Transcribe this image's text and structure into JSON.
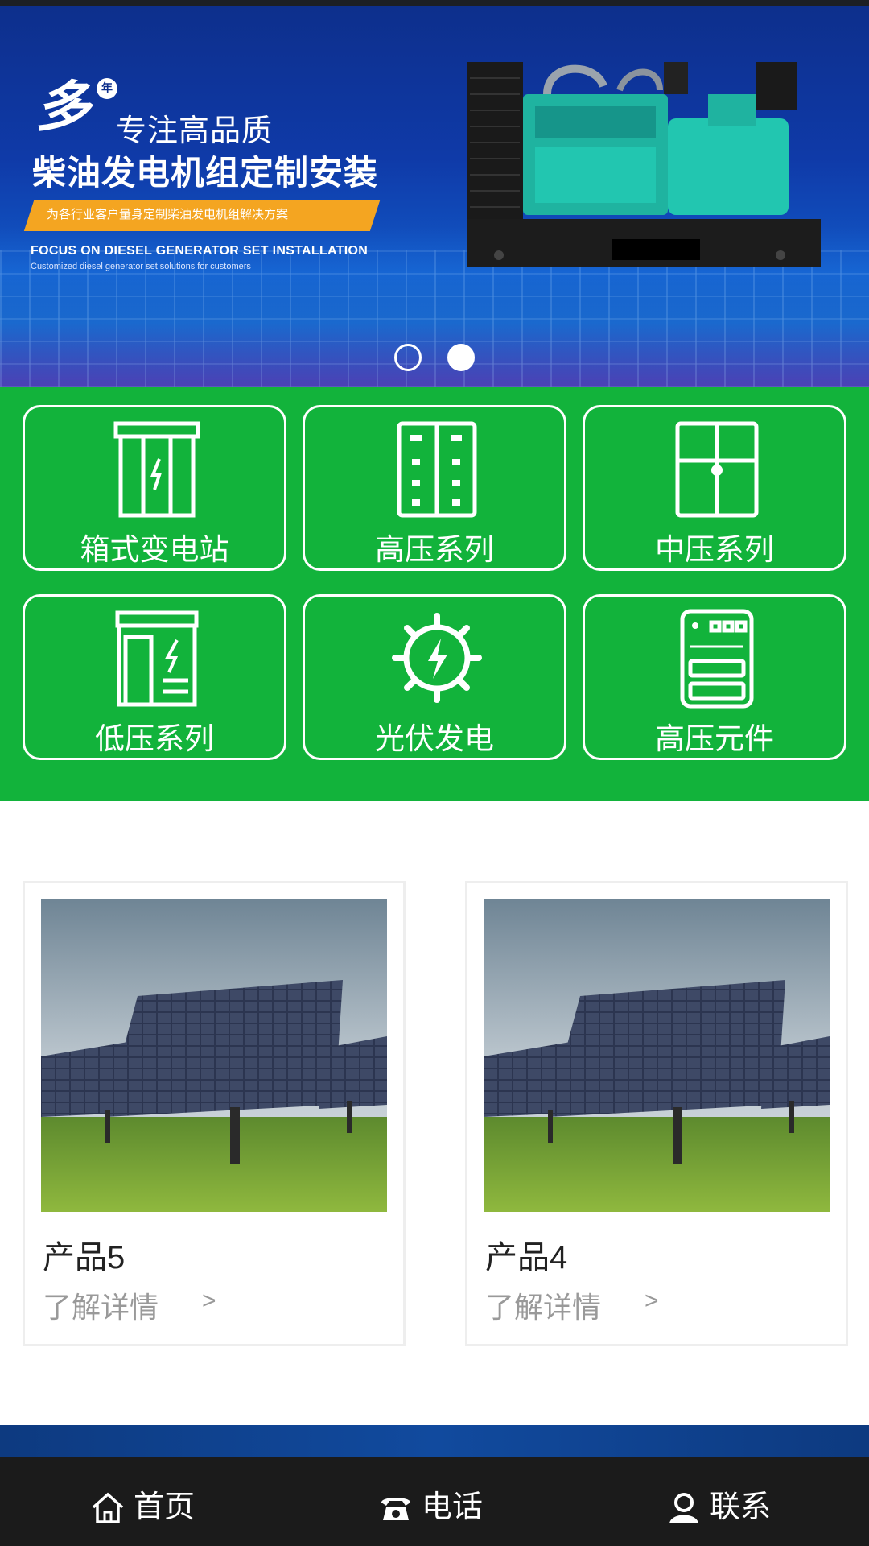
{
  "banner": {
    "logo_mark": "多",
    "logo_badge": "年",
    "slogan_line1": "专注高品质",
    "slogan_line2": "柴油发电机组定制安装",
    "ribbon_text": "为各行业客户量身定制柴油发电机组解决方案",
    "english_title": "FOCUS ON DIESEL GENERATOR SET INSTALLATION",
    "english_subtitle": "Customized diesel generator set solutions for customers",
    "slides_total": 2,
    "active_slide": 2
  },
  "categories": [
    {
      "label": "箱式变电站",
      "icon": "box-substation-icon"
    },
    {
      "label": "高压系列",
      "icon": "high-voltage-cabinet-icon"
    },
    {
      "label": "中压系列",
      "icon": "medium-voltage-cabinet-icon"
    },
    {
      "label": "低压系列",
      "icon": "low-voltage-cabinet-icon"
    },
    {
      "label": "光伏发电",
      "icon": "solar-gear-icon"
    },
    {
      "label": "高压元件",
      "icon": "high-voltage-component-icon"
    }
  ],
  "products": [
    {
      "name": "产品5",
      "more_label": "了解详情",
      "arrow": ">",
      "image": "solar-panels-photo"
    },
    {
      "name": "产品4",
      "more_label": "了解详情",
      "arrow": ">",
      "image": "solar-panels-photo"
    }
  ],
  "tabbar": {
    "home": "首页",
    "phone": "电话",
    "contact": "联系"
  },
  "colors": {
    "category_bg": "#12b33b",
    "banner_bg": "#0f3aa8",
    "ribbon": "#f4a521",
    "tabbar_bg": "#1b1b1b"
  }
}
